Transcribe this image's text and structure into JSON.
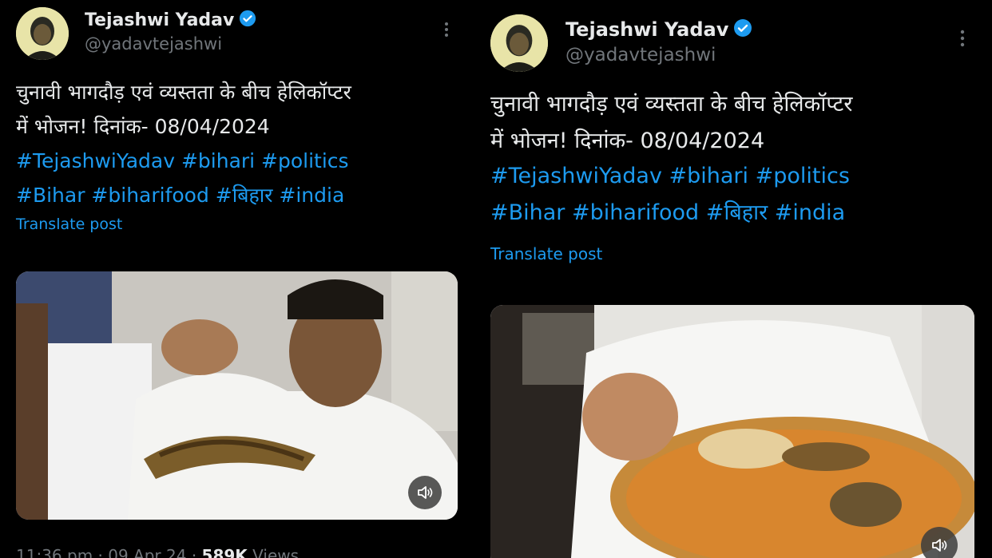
{
  "tweet": {
    "author_name": "Tejashwi Yadav",
    "author_handle": "@yadavtejashwi",
    "text_line_1": "चुनावी भागदौड़ एवं व्यस्तता के बीच हेलिकॉप्टर",
    "text_line_2": "में भोजन! दिनांक- 08/04/2024",
    "hashtags_line_1": "#TejashwiYadav #bihari #politics",
    "hashtags_line_2": "#Bihar #biharifood #बिहार #india",
    "translate_label": "Translate post",
    "more_icon": "more-vertical-icon",
    "verified_icon": "verified-badge-icon",
    "mute_icon": "speaker-icon"
  },
  "meta": {
    "time": "11:36 pm",
    "date": "09 Apr 24",
    "views_count": "589K",
    "views_label": "Views"
  },
  "colors": {
    "background": "#000000",
    "text": "#e7e9ea",
    "secondary": "#71767b",
    "accent": "#1d9bf0"
  }
}
